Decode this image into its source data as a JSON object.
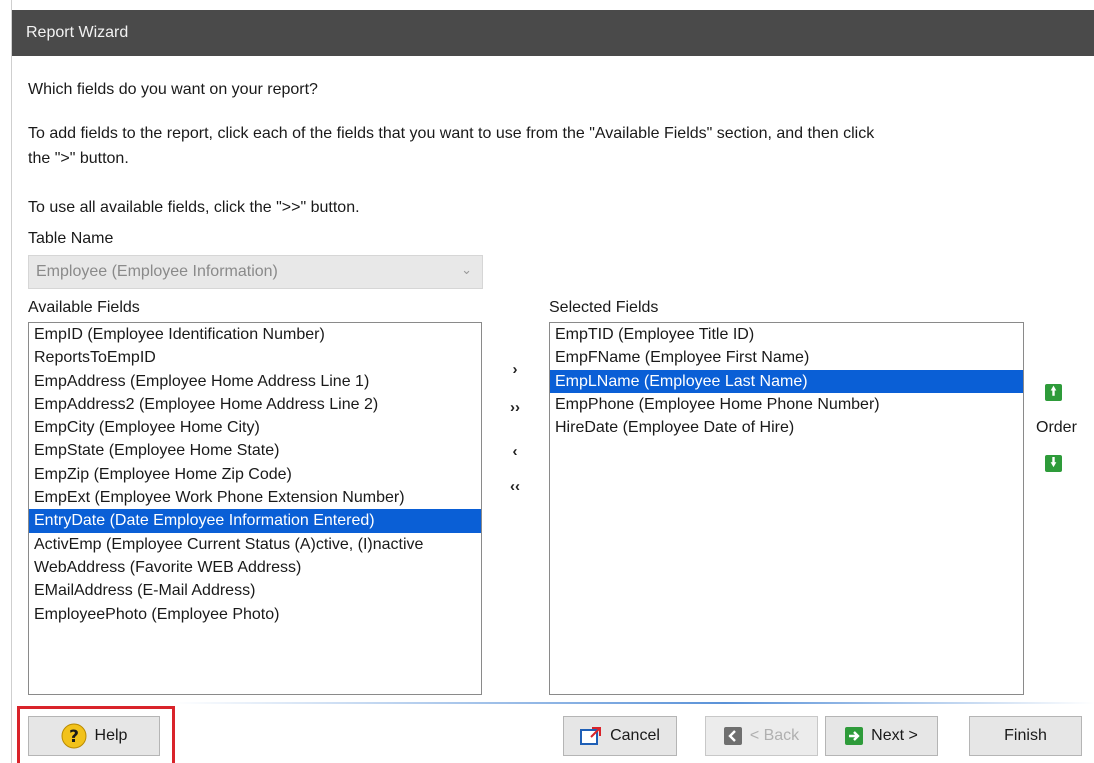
{
  "window": {
    "title": "Report Wizard"
  },
  "instructions": {
    "question": "Which fields do you want on your report?",
    "add_line1": "To add fields to the report, click each of the fields that you want to use from the \"Available Fields\" section, and then click",
    "add_line2": "the \">\" button.",
    "all_line": "To use all available fields, click the \">>\" button."
  },
  "table": {
    "label": "Table Name",
    "selected": "Employee  (Employee Information)"
  },
  "available": {
    "label": "Available Fields",
    "selected_index": 8,
    "items": [
      "EmpID  (Employee Identification Number)",
      "ReportsToEmpID",
      "EmpAddress  (Employee Home Address Line 1)",
      "EmpAddress2  (Employee Home Address Line 2)",
      "EmpCity  (Employee Home City)",
      "EmpState  (Employee Home State)",
      "EmpZip  (Employee Home Zip Code)",
      "EmpExt  (Employee Work Phone Extension Number)",
      "EntryDate  (Date Employee Information Entered)",
      "ActivEmp  (Employee Current Status (A)ctive, (I)nactive",
      "WebAddress  (Favorite WEB Address)",
      "EMailAddress  (E-Mail Address)",
      "EmployeePhoto  (Employee Photo)"
    ]
  },
  "selected": {
    "label": "Selected Fields",
    "selected_index": 2,
    "items": [
      "EmpTID  (Employee Title ID)",
      "EmpFName  (Employee First Name)",
      "EmpLName  (Employee Last Name)",
      "EmpPhone  (Employee Home Phone Number)",
      "HireDate  (Employee Date of Hire)"
    ]
  },
  "move_buttons": {
    "add": "›",
    "add_all": "››",
    "remove": "‹",
    "remove_all": "‹‹"
  },
  "order": {
    "label": "Order",
    "up_icon": "arrow-up-icon",
    "down_icon": "arrow-down-icon"
  },
  "footer": {
    "help": "Help",
    "cancel": "Cancel",
    "back": "< Back",
    "next": "Next >",
    "finish": "Finish"
  },
  "colors": {
    "selection": "#0a5fd6",
    "titlebar": "#4a4a4a",
    "highlight_frame": "#d9232a",
    "order_arrows": "#2e9b3a"
  }
}
